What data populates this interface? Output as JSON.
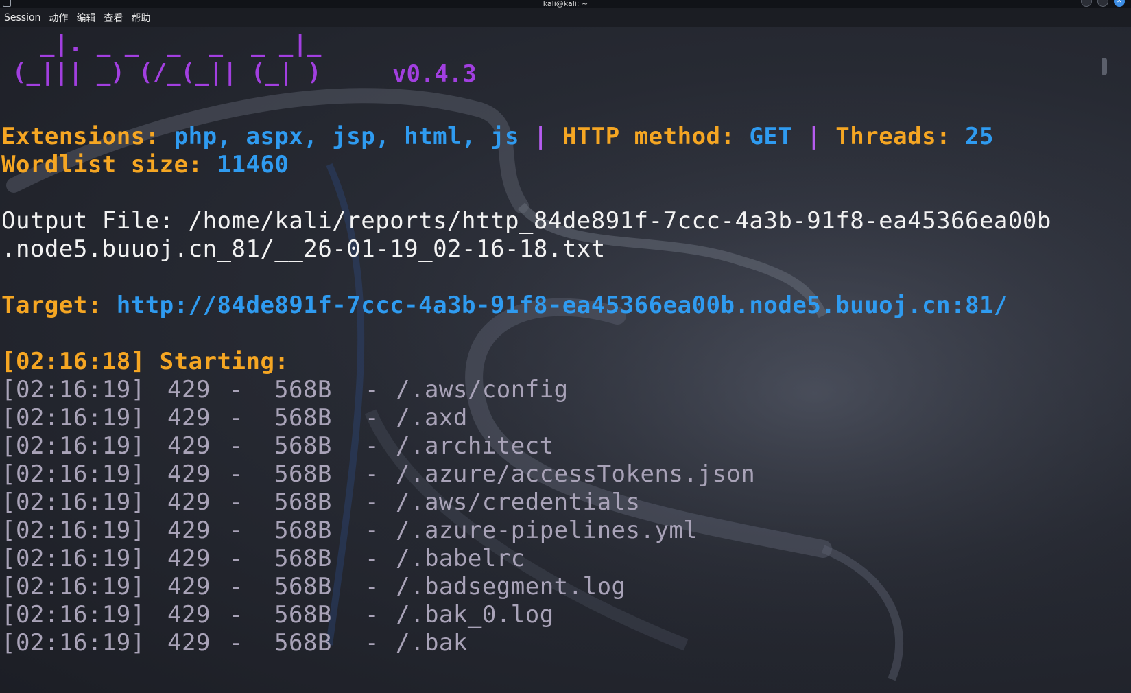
{
  "window": {
    "title": "kali@kali: ~"
  },
  "menu": {
    "items": [
      "Session",
      "动作",
      "编辑",
      "查看",
      "帮助"
    ]
  },
  "banner": {
    "line1": "  _|. _ _  _  _  _ _|_",
    "line2": "(_||| _) (/_(_|| (_| )",
    "version": "v0.4.3"
  },
  "config": {
    "extensions_label": "Extensions: ",
    "extensions_value": "php, aspx, jsp, html, js",
    "sep1": " | ",
    "method_label": "HTTP method: ",
    "method_value": "GET",
    "sep2": " | ",
    "threads_label": "Threads: ",
    "threads_value": "25",
    "wordlist_label": "Wordlist size: ",
    "wordlist_value": "11460"
  },
  "output": {
    "line1": "Output File: /home/kali/reports/http_84de891f-7ccc-4a3b-91f8-ea45366ea00b",
    "line2": ".node5.buuoj.cn_81/__26-01-19_02-16-18.txt"
  },
  "target": {
    "label": "Target: ",
    "url": "http://84de891f-7ccc-4a3b-91f8-ea45366ea00b.node5.buuoj.cn:81/"
  },
  "start": {
    "text": "[02:16:18] Starting:"
  },
  "results": [
    {
      "time": "[02:16:19]",
      "status": "429",
      "size": "568B",
      "path": "/.aws/config"
    },
    {
      "time": "[02:16:19]",
      "status": "429",
      "size": "568B",
      "path": "/.axd"
    },
    {
      "time": "[02:16:19]",
      "status": "429",
      "size": "568B",
      "path": "/.architect"
    },
    {
      "time": "[02:16:19]",
      "status": "429",
      "size": "568B",
      "path": "/.azure/accessTokens.json"
    },
    {
      "time": "[02:16:19]",
      "status": "429",
      "size": "568B",
      "path": "/.aws/credentials"
    },
    {
      "time": "[02:16:19]",
      "status": "429",
      "size": "568B",
      "path": "/.azure-pipelines.yml"
    },
    {
      "time": "[02:16:19]",
      "status": "429",
      "size": "568B",
      "path": "/.babelrc"
    },
    {
      "time": "[02:16:19]",
      "status": "429",
      "size": "568B",
      "path": "/.badsegment.log"
    },
    {
      "time": "[02:16:19]",
      "status": "429",
      "size": "568B",
      "path": "/.bak_0.log"
    },
    {
      "time": "[02:16:19]",
      "status": "429",
      "size": "568B",
      "path": "/.bak"
    }
  ],
  "colors": {
    "label": "#f5a623",
    "value": "#2f9bf0",
    "banner": "#a23fe0",
    "text": "#f2f2f2",
    "result": "#a9a3b8"
  }
}
